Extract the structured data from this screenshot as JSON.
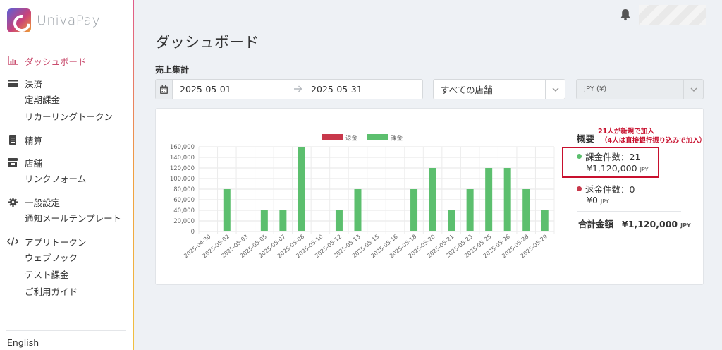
{
  "app": {
    "logo_text": "UnivaPay"
  },
  "sidebar": {
    "items": [
      {
        "label": "ダッシュボード",
        "icon": "bar-chart-icon",
        "active": true
      },
      {
        "label": "決済",
        "icon": "credit-card-icon"
      },
      {
        "label": "定期課金",
        "sub": true
      },
      {
        "label": "リカーリングトークン",
        "sub": true
      },
      {
        "label": "精算",
        "icon": "document-icon"
      },
      {
        "label": "店舗",
        "icon": "store-icon"
      },
      {
        "label": "リンクフォーム",
        "sub": true
      },
      {
        "label": "一般設定",
        "icon": "gear-icon"
      },
      {
        "label": "通知メールテンプレート",
        "sub": true
      },
      {
        "label": "アプリトークン",
        "icon": "code-icon"
      },
      {
        "label": "ウェブフック",
        "sub": true
      },
      {
        "label": "テスト課金",
        "sub": true
      },
      {
        "label": "ご利用ガイド",
        "sub": true
      }
    ],
    "language": "English"
  },
  "page": {
    "title": "ダッシュボード",
    "section_label": "売上集計"
  },
  "filters": {
    "date_from": "2025-05-01",
    "date_to": "2025-05-31",
    "store_select": "すべての店舗",
    "currency_select": "JPY (¥)"
  },
  "summary": {
    "title": "概要",
    "annotation_line1": "21人が新規で加入",
    "annotation_line2": "（4人は直接銀行振り込みで加入）",
    "charge_label": "課金件数：21",
    "charge_amount": "¥1,120,000",
    "refund_label": "返金件数：0",
    "refund_amount": "¥0",
    "currency": "JPY",
    "total_label": "合計金額",
    "total_amount": "¥1,120,000"
  },
  "colors": {
    "charge": "#5cbf6e",
    "refund": "#c8384b",
    "accent": "#c94c6e",
    "annotation": "#c8102e"
  },
  "chart_data": {
    "type": "bar",
    "legend": [
      "返金",
      "課金"
    ],
    "categories": [
      "2025-04-30",
      "2025-05-02",
      "2025-05-03",
      "2025-05-05",
      "2025-05-07",
      "2025-05-08",
      "2025-05-10",
      "2025-05-12",
      "2025-05-13",
      "2025-05-15",
      "2025-05-16",
      "2025-05-18",
      "2025-05-20",
      "2025-05-21",
      "2025-05-23",
      "2025-05-25",
      "2025-05-26",
      "2025-05-28",
      "2025-05-29"
    ],
    "series": [
      {
        "name": "返金",
        "values": [
          0,
          0,
          0,
          0,
          0,
          0,
          0,
          0,
          0,
          0,
          0,
          0,
          0,
          0,
          0,
          0,
          0,
          0,
          0
        ]
      },
      {
        "name": "課金",
        "values": [
          0,
          80000,
          0,
          40000,
          40000,
          160000,
          0,
          40000,
          80000,
          0,
          0,
          80000,
          120000,
          40000,
          80000,
          120000,
          120000,
          80000,
          40000
        ]
      }
    ],
    "yticks": [
      "160,000",
      "140,000",
      "120,000",
      "100,000",
      "80,000",
      "60,000",
      "40,000",
      "20,000",
      "0"
    ],
    "ylim": [
      0,
      160000
    ],
    "grid": true,
    "legend_position": "top"
  }
}
